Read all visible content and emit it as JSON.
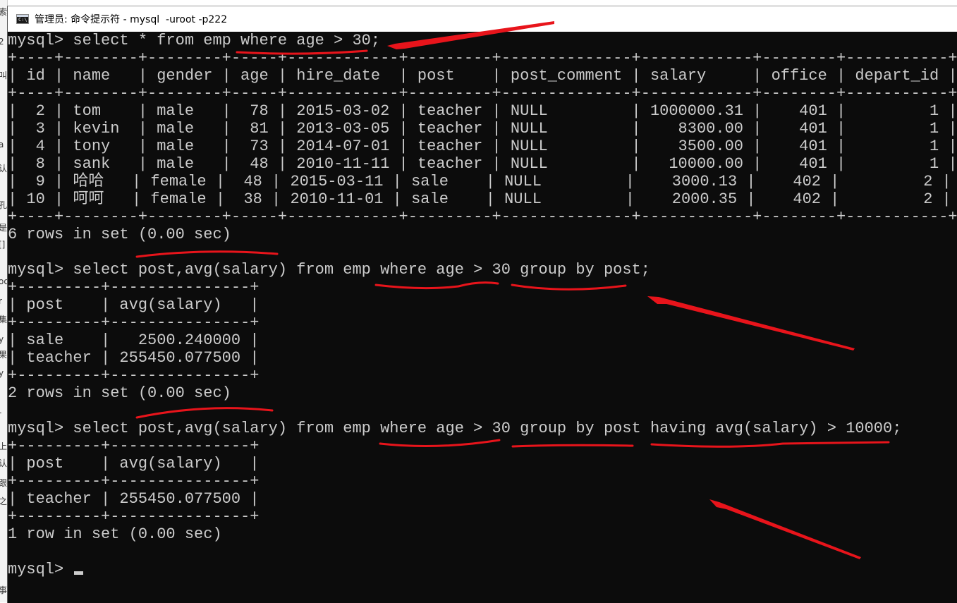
{
  "window": {
    "title": "管理员: 命令提示符 - mysql  -uroot -p222",
    "icon": "cmd-icon"
  },
  "background_strip": {
    "glyphs": [
      "索",
      "2",
      "叫",
      "a",
      "认",
      "孔",
      "是",
      "[]",
      "oo",
      "r",
      "集",
      "y",
      "果",
      "y",
      "-",
      "上",
      "认",
      "跟",
      "之",
      "事"
    ]
  },
  "terminal": {
    "lines": [
      "mysql> select * from emp where age > 30;",
      "+----+--------+--------+-----+------------+---------+--------------+------------+--------+-----------+",
      "| id | name   | gender | age | hire_date  | post    | post_comment | salary     | office | depart_id |",
      "+----+--------+--------+-----+------------+---------+--------------+------------+--------+-----------+",
      "|  2 | tom    | male   |  78 | 2015-03-02 | teacher | NULL         | 1000000.31 |    401 |         1 |",
      "|  3 | kevin  | male   |  81 | 2013-03-05 | teacher | NULL         |    8300.00 |    401 |         1 |",
      "|  4 | tony   | male   |  73 | 2014-07-01 | teacher | NULL         |    3500.00 |    401 |         1 |",
      "|  8 | sank   | male   |  48 | 2010-11-11 | teacher | NULL         |   10000.00 |    401 |         1 |",
      "|  9 | 哈哈   | female |  48 | 2015-03-11 | sale    | NULL         |    3000.13 |    402 |         2 |",
      "| 10 | 呵呵   | female |  38 | 2010-11-01 | sale    | NULL         |    2000.35 |    402 |         2 |",
      "+----+--------+--------+-----+------------+---------+--------------+------------+--------+-----------+",
      "6 rows in set (0.00 sec)",
      "",
      "mysql> select post,avg(salary) from emp where age > 30 group by post;",
      "+---------+---------------+",
      "| post    | avg(salary)   |",
      "+---------+---------------+",
      "| sale    |   2500.240000 |",
      "| teacher | 255450.077500 |",
      "+---------+---------------+",
      "2 rows in set (0.00 sec)",
      "",
      "mysql> select post,avg(salary) from emp where age > 30 group by post having avg(salary) > 10000;",
      "+---------+---------------+",
      "| post    | avg(salary)   |",
      "+---------+---------------+",
      "| teacher | 255450.077500 |",
      "+---------+---------------+",
      "1 row in set (0.00 sec)",
      "",
      "mysql> "
    ]
  },
  "annotation_color": "#e8141b"
}
